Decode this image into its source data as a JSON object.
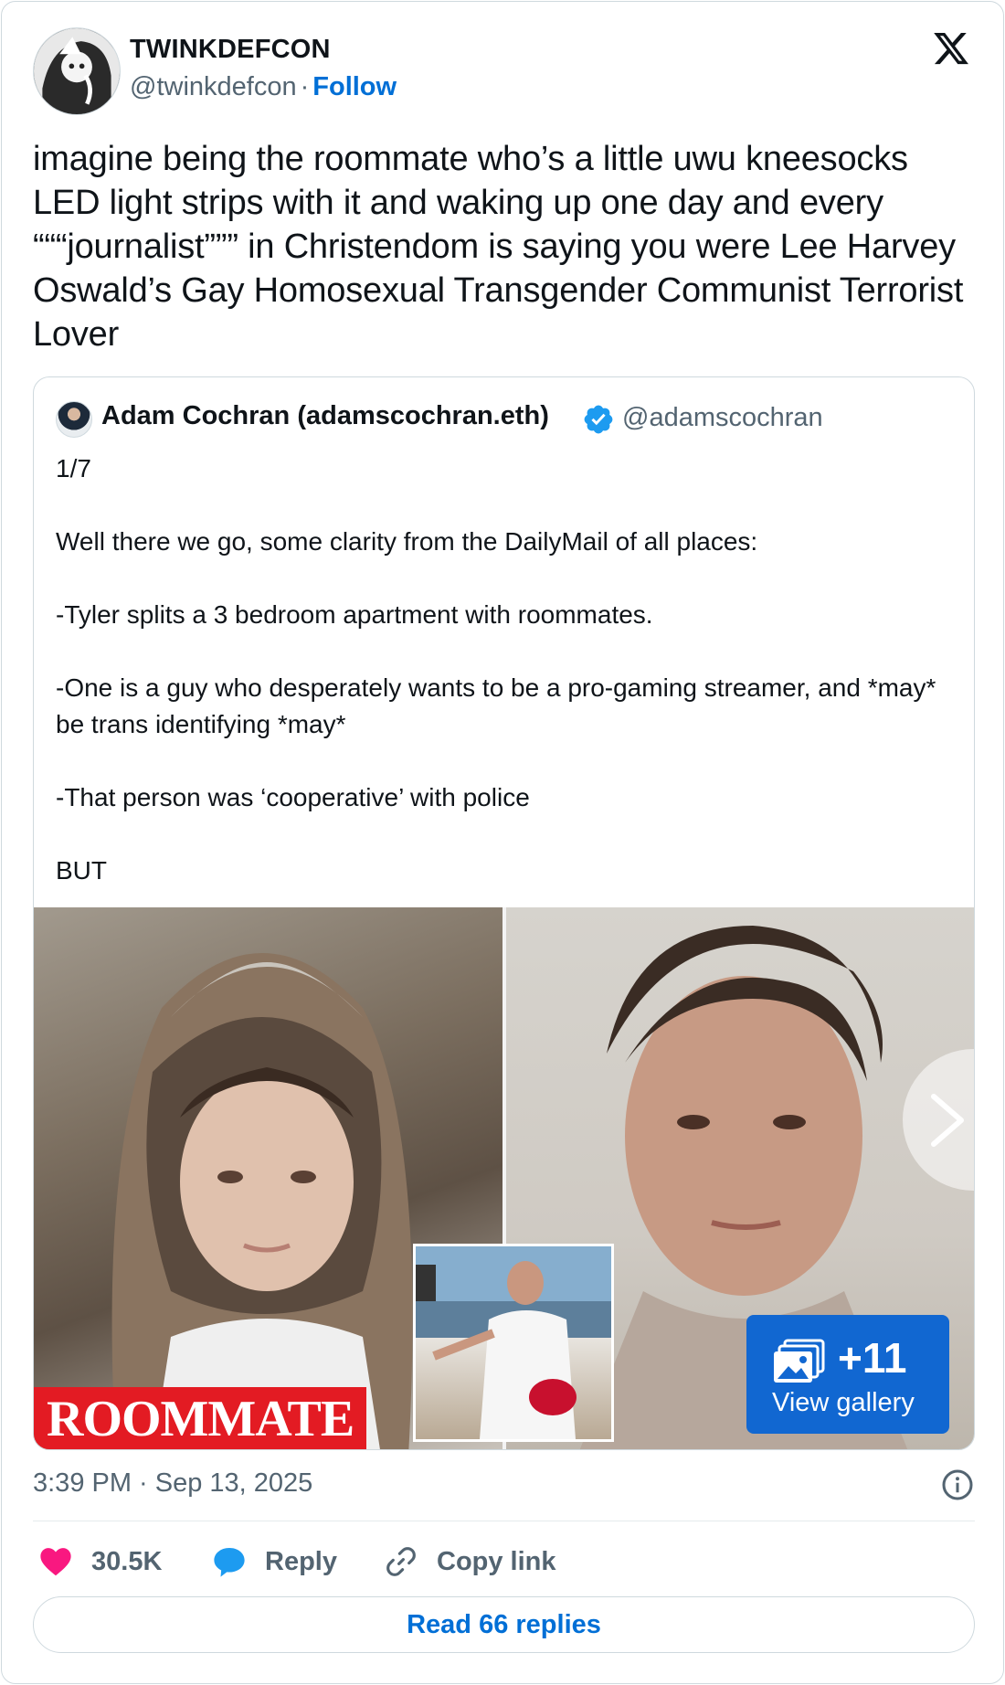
{
  "author": {
    "display_name": "TWINKDEFCON",
    "handle": "@twinkdefcon",
    "separator": "·",
    "follow_label": "Follow",
    "avatar_icon": "avatar-image"
  },
  "platform_logo": "x-logo-icon",
  "tweet": {
    "text": "imagine being the roommate who’s a little uwu kneesocks LED light strips with it and waking up one day and every “““journalist””” in Christendom is saying you were Lee Harvey Oswald’s Gay Homosexual Transgender Communist Terrorist Lover"
  },
  "quoted": {
    "display_name": "Adam Cochran (adamscochran.eth)",
    "handle": "@adamscochran",
    "verified_color": "#1d9bf0",
    "paragraphs": [
      "1/7",
      "Well there we go, some clarity from the DailyMail of all places:",
      "-Tyler splits a 3 bedroom apartment with roommates.",
      "-One is a guy who desperately wants to be a pro-gaming streamer, and *may* be trans identifying *may*",
      "-That person was ‘cooperative’ with police",
      "BUT"
    ],
    "media": {
      "left_caption": "ROOMMATE",
      "gallery_count": "+11",
      "gallery_label": "View gallery"
    }
  },
  "footer": {
    "timestamp": "3:39 PM · Sep 13, 2025",
    "likes": "30.5K",
    "reply_label": "Reply",
    "copy_label": "Copy link",
    "read_replies": "Read 66 replies"
  },
  "colors": {
    "link_blue": "#006fd6",
    "like_pink": "#f91880",
    "reply_blue": "#1d9bf0",
    "gallery_blue": "#1167d1",
    "caption_red": "#e31b23"
  }
}
